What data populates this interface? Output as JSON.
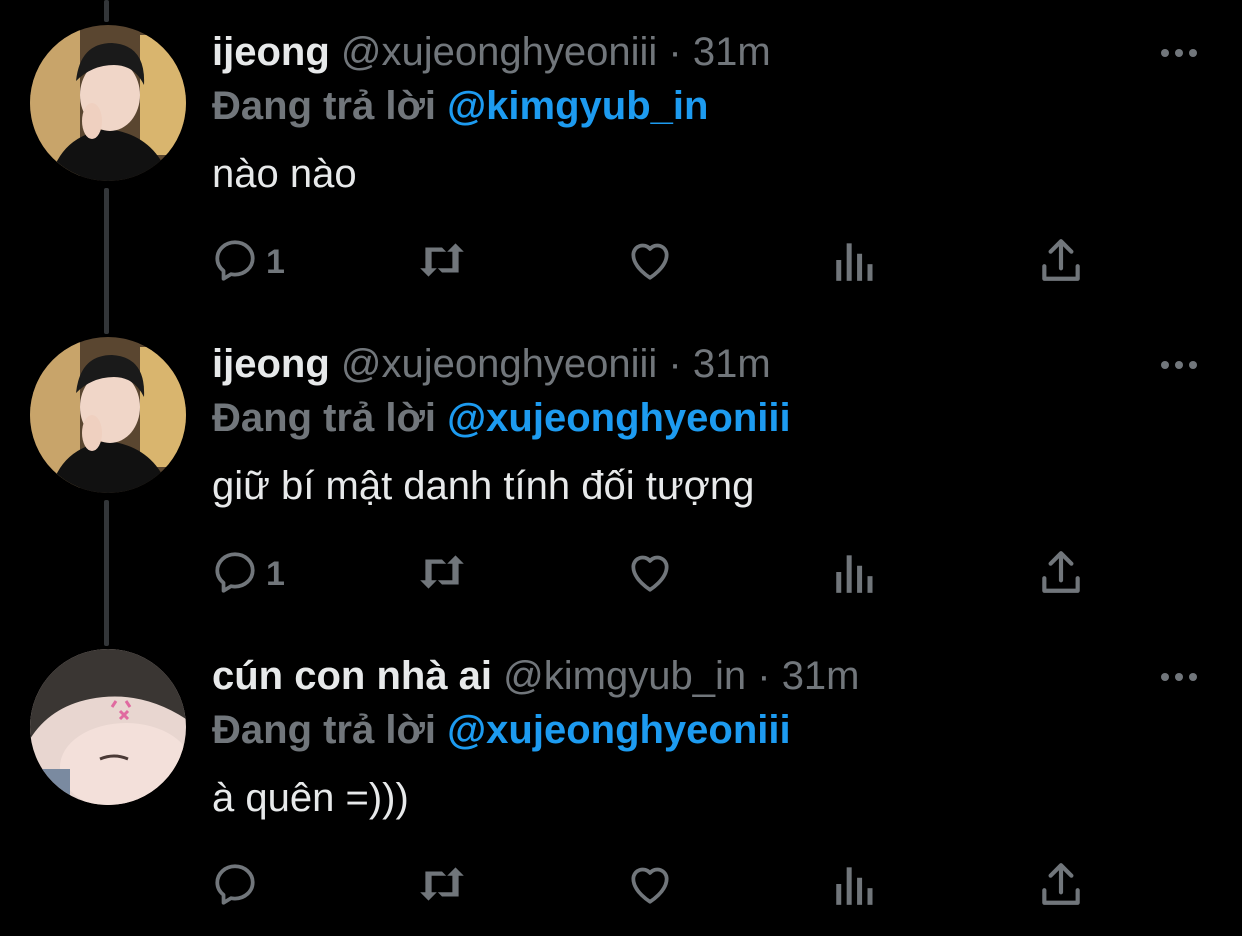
{
  "colors": {
    "background": "#000000",
    "text": "#e7e9ea",
    "muted": "#71767b",
    "mention": "#1d9bf0",
    "thread_line": "#333639"
  },
  "tweets": [
    {
      "name": "ijeong",
      "handle": "@xujeonghyeoniii",
      "separator": "·",
      "time": "31m",
      "reply_prefix": "Đang trả lời",
      "reply_to": "@kimgyub_in",
      "text": "nào nào",
      "reply_count": "1",
      "avatar_icon": "avatar-boy-hand-pose",
      "more_icon": "more-horizontal-icon"
    },
    {
      "name": "ijeong",
      "handle": "@xujeonghyeoniii",
      "separator": "·",
      "time": "31m",
      "reply_prefix": "Đang trả lời",
      "reply_to": "@xujeonghyeoniii",
      "text": "giữ bí mật danh tính đối tượng",
      "reply_count": "1",
      "avatar_icon": "avatar-boy-hand-pose",
      "more_icon": "more-horizontal-icon"
    },
    {
      "name": "cún con nhà ai",
      "handle": "@kimgyub_in",
      "separator": "·",
      "time": "31m",
      "reply_prefix": "Đang trả lời",
      "reply_to": "@xujeonghyeoniii",
      "text": "à quên =)))",
      "reply_count": "",
      "avatar_icon": "avatar-face-closeup",
      "more_icon": "more-horizontal-icon"
    }
  ],
  "action_icons": [
    "reply-icon",
    "retweet-icon",
    "like-icon",
    "views-icon",
    "share-icon"
  ]
}
